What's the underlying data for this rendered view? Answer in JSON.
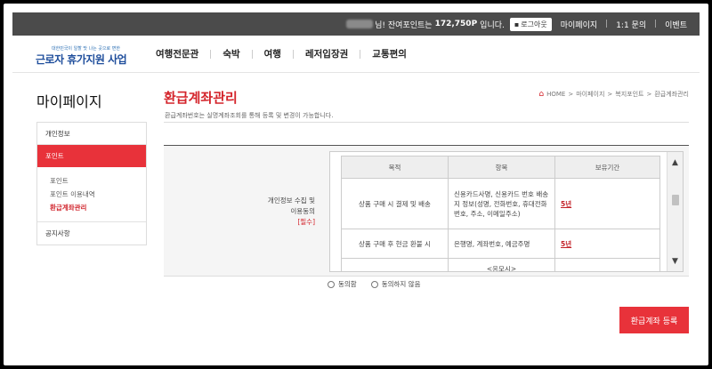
{
  "topbar": {
    "greeting_suffix": "님! 잔여포인트는",
    "points": "172,750P",
    "points_suffix": "입니다.",
    "logout_label": "로그아웃",
    "links": [
      "마이페이지",
      "1:1 문의",
      "이벤트"
    ]
  },
  "logo": {
    "tagline": "대한민국이 일할 맛 나는 곳으로 변한",
    "name": "근로자 휴가지원 사업"
  },
  "gnb": {
    "items": [
      "여행전문관",
      "숙박",
      "여행",
      "레저입장권",
      "교통편의"
    ]
  },
  "lnb": {
    "title": "마이페이지",
    "items": [
      "개인정보",
      "포인트",
      "공지사항"
    ],
    "sub_items": [
      "포인트",
      "포인트 이용내역",
      "환급계좌관리"
    ]
  },
  "page": {
    "title": "환급계좌관리",
    "description": "환급계좌번호는 실명계좌조회를 통해 등록 및 변경이 가능합니다.",
    "breadcrumb": [
      "HOME",
      "마이페이지",
      "복지포인트",
      "환급계좌관리"
    ]
  },
  "consent": {
    "label_line1": "개인정보 수집 및",
    "label_line2": "이용동의",
    "required": "[필수]",
    "headers": [
      "목적",
      "항목",
      "보유기간"
    ],
    "rows": [
      {
        "purpose": "상품 구매 시 결제 및 배송",
        "items": "신용카드사명, 신용카드 번호 배송지 정보(성명, 전화번호, 휴대전화번호, 주소, 이메일주소)",
        "period": "5년"
      },
      {
        "purpose": "상품 구매 후 현금 환불 시",
        "items": "은행명, 계좌번호, 예금주명",
        "period": "5년"
      },
      {
        "purpose": "",
        "items": "<응모시>",
        "period": ""
      }
    ],
    "agree_label": "동의함",
    "disagree_label": "동의하지 않음"
  },
  "actions": {
    "register_label": "환급계좌 등록"
  },
  "colors": {
    "accent": "#e8323a",
    "topbar": "#4b4b4b"
  }
}
